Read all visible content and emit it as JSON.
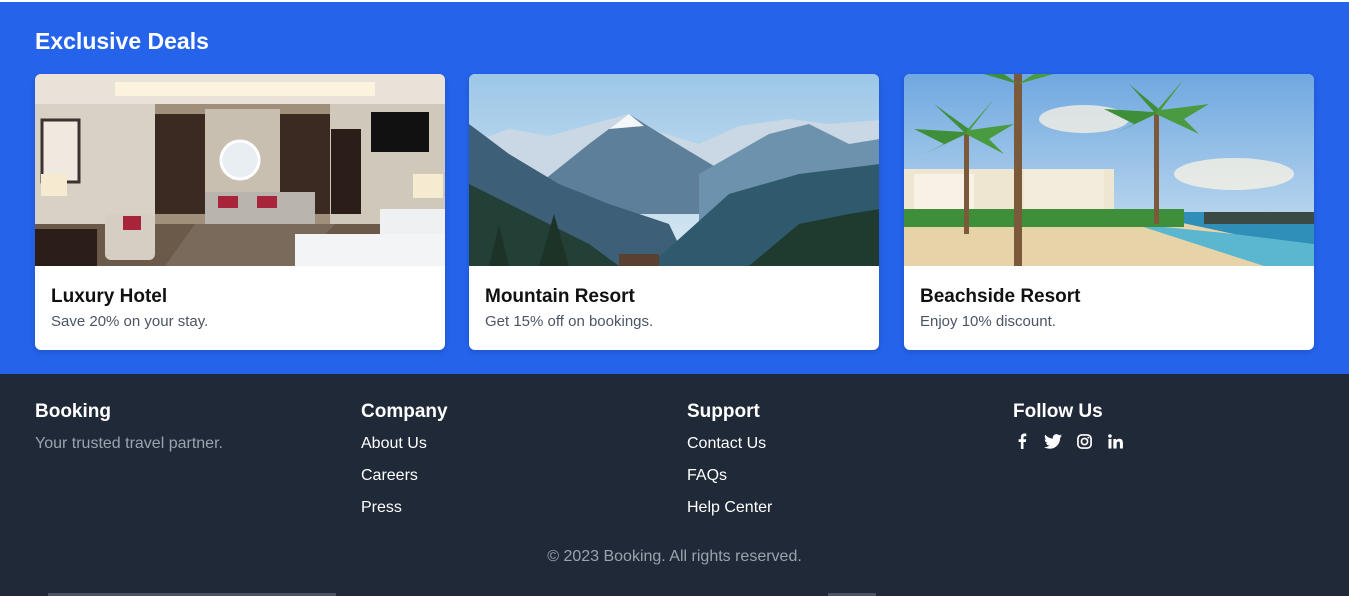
{
  "deals": {
    "title": "Exclusive Deals",
    "cards": [
      {
        "title": "Luxury Hotel",
        "description": "Save 20% on your stay.",
        "image": "hotel-room-image"
      },
      {
        "title": "Mountain Resort",
        "description": "Get 15% off on bookings.",
        "image": "mountain-landscape-image"
      },
      {
        "title": "Beachside Resort",
        "description": "Enjoy 10% discount.",
        "image": "beach-palm-trees-image"
      }
    ]
  },
  "footer": {
    "booking": {
      "title": "Booking",
      "tagline": "Your trusted travel partner."
    },
    "company": {
      "title": "Company",
      "links": [
        "About Us",
        "Careers",
        "Press"
      ]
    },
    "support": {
      "title": "Support",
      "links": [
        "Contact Us",
        "FAQs",
        "Help Center"
      ]
    },
    "follow": {
      "title": "Follow Us",
      "icons": [
        "facebook-icon",
        "twitter-icon",
        "instagram-icon",
        "linkedin-icon"
      ]
    },
    "copyright": "© 2023 Booking. All rights reserved."
  },
  "colors": {
    "primary": "#2563eb",
    "footer_bg": "#1f2937",
    "muted_text": "#9ca3af"
  }
}
